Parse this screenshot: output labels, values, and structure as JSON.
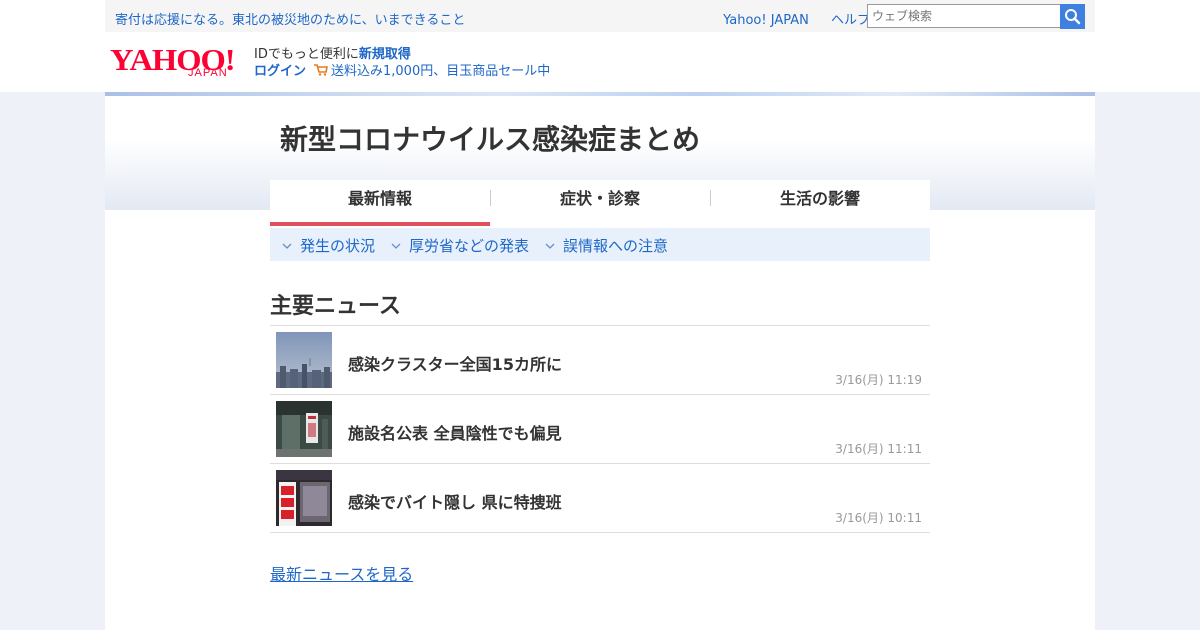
{
  "top_bar": {
    "promo_text": "寄付は応援になる。東北の被災地のために、いまできること",
    "links": [
      "Yahoo! JAPAN",
      "ヘルプ"
    ],
    "search_placeholder": "ウェブ検索"
  },
  "masthead": {
    "logo_text": "YAHOO!",
    "logo_sub": "JAPAN",
    "id_prefix": "IDでもっと便利に",
    "id_link": "新規取得",
    "login": "ログイン",
    "cart_promo": "送料込み1,000円、目玉商品セール中"
  },
  "page": {
    "title": "新型コロナウイルス感染症まとめ",
    "tabs": [
      "最新情報",
      "症状・診察",
      "生活の影響"
    ],
    "active_tab": 0,
    "subnav": [
      "発生の状況",
      "厚労省などの発表",
      "誤情報への注意"
    ]
  },
  "news": {
    "section_title": "主要ニュース",
    "items": [
      {
        "title": "感染クラスター全国15カ所に",
        "time": "3/16(月) 11:19"
      },
      {
        "title": "施設名公表 全員陰性でも偏見",
        "time": "3/16(月) 11:11"
      },
      {
        "title": "感染でバイト隠し 県に特捜班",
        "time": "3/16(月) 10:11"
      }
    ],
    "more_link": "最新ニュースを見る"
  },
  "colors": {
    "link": "#1e67c8",
    "logo_red": "#ff0033",
    "active_tab_underline": "#e0505a",
    "search_button": "#3e7fdf",
    "subnav_bg": "#e8f1fb"
  },
  "thumbnails": [
    "city-skyline-image",
    "facility-notice-image",
    "closed-shop-image"
  ]
}
